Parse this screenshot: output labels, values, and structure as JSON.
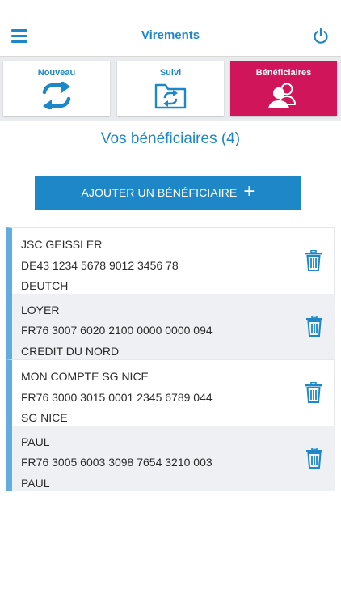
{
  "header": {
    "title": "Virements",
    "menu_icon": "hamburger-menu-icon",
    "power_icon": "power-icon",
    "accent": "#1e87c8"
  },
  "tabs": [
    {
      "label": "Nouveau",
      "icon": "transfer-arrows-icon",
      "active": false
    },
    {
      "label": "Suivi",
      "icon": "folder-transfer-icon",
      "active": false
    },
    {
      "label": "Bénéficiaires",
      "icon": "beneficiaries-people-icon",
      "active": true
    }
  ],
  "active_tab_color": "#d1155a",
  "section": {
    "title": "Vos bénéficiaires (4)"
  },
  "add_button": {
    "label": "AJOUTER UN BÉNÉFICIAIRE",
    "plus": "+"
  },
  "beneficiaries": [
    {
      "name": "JSC GEISSLER",
      "iban": "DE43 1234 5678 9012 3456 78",
      "bank": "DEUTCH"
    },
    {
      "name": "LOYER",
      "iban": "FR76 3007 6020 2100 0000 0000 094",
      "bank": "CREDIT DU NORD"
    },
    {
      "name": "MON COMPTE SG NICE",
      "iban": "FR76 3000 3015 0001 2345 6789 044",
      "bank": "SG NICE"
    },
    {
      "name": "PAUL",
      "iban": "FR76 3005 6003 3098 7654 3210 003",
      "bank": "PAUL"
    }
  ]
}
